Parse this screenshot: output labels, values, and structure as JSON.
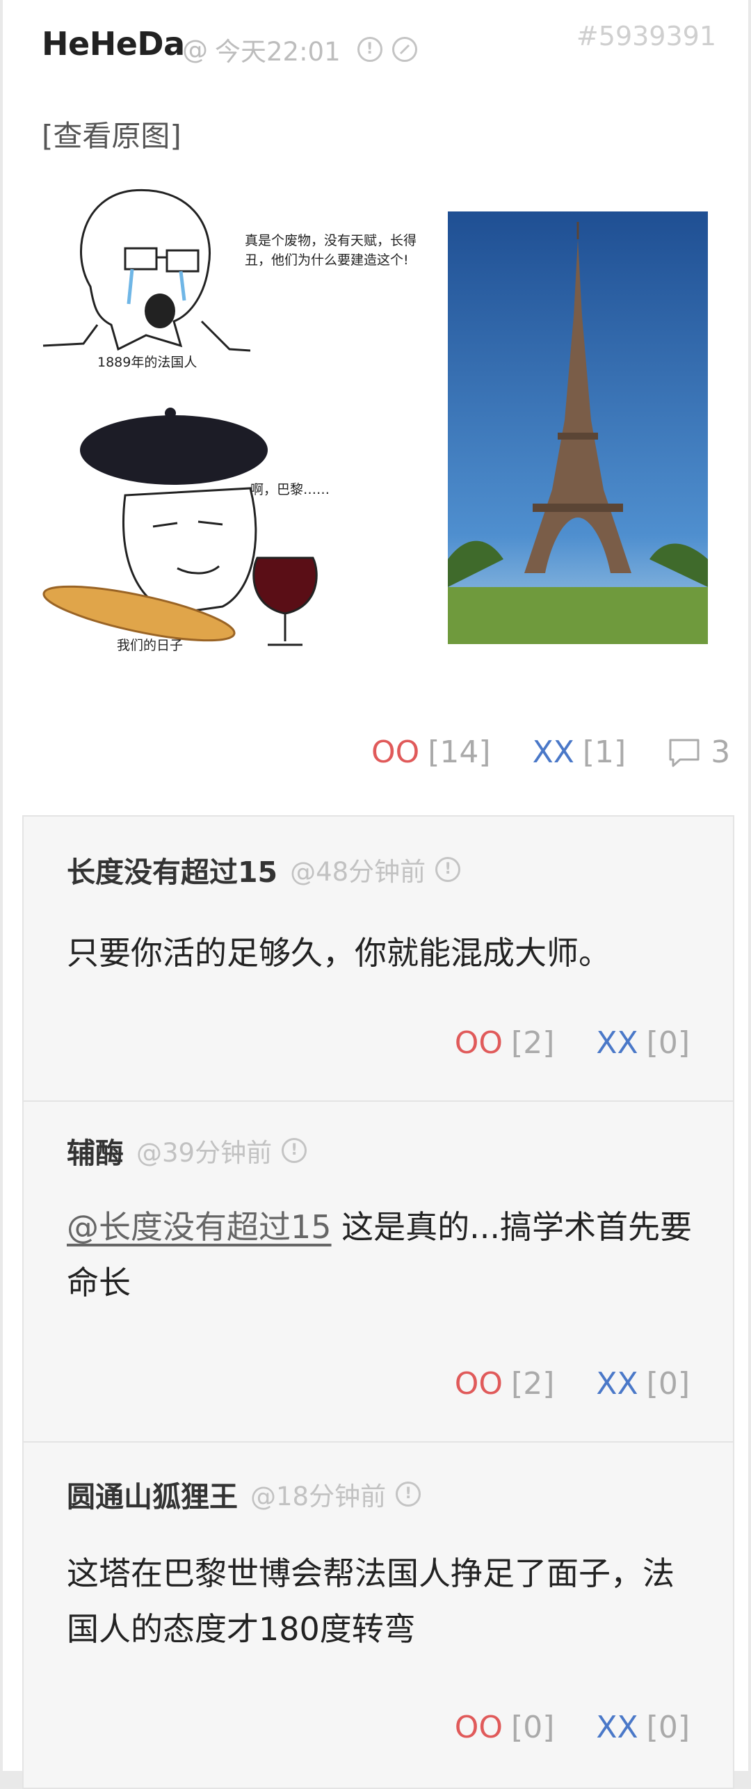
{
  "post": {
    "author": "HeHeDa",
    "at": "@",
    "time": "今天22:01",
    "id": "#5939391",
    "view_original": "[查看原图]",
    "image": {
      "top_text": "真是个废物，没有天赋，长得丑，他们为什么要建造这个!",
      "top_caption": "1889年的法国人",
      "bottom_text": "啊，巴黎……",
      "bottom_caption": "我们的日子"
    },
    "votes": {
      "oo_label": "OO",
      "oo_count": "[14]",
      "xx_label": "XX",
      "xx_count": "[1]",
      "comments": "3"
    }
  },
  "comments": [
    {
      "author": "长度没有超过15",
      "time": "@48分钟前",
      "mention": "",
      "body": "只要你活的足够久，你就能混成大师。",
      "oo_label": "OO",
      "oo_count": "[2]",
      "xx_label": "XX",
      "xx_count": "[0]"
    },
    {
      "author": "辅酶",
      "time": "@39分钟前",
      "mention": "@长度没有超过15",
      "body": " 这是真的...搞学术首先要命长",
      "oo_label": "OO",
      "oo_count": "[2]",
      "xx_label": "XX",
      "xx_count": "[0]"
    },
    {
      "author": "圆通山狐狸王",
      "time": "@18分钟前",
      "mention": "",
      "body": "这塔在巴黎世博会帮法国人挣足了面子，法国人的态度才180度转弯",
      "oo_label": "OO",
      "oo_count": "[0]",
      "xx_label": "XX",
      "xx_count": "[0]"
    }
  ],
  "colors": {
    "oo": "#e05a5a",
    "xx": "#4a78c8",
    "muted": "#aaaaaa"
  }
}
